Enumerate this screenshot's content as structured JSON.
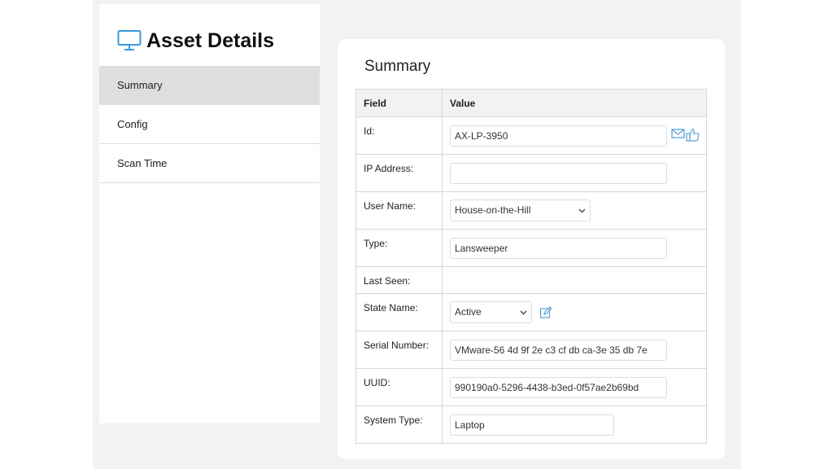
{
  "sidebar": {
    "title": "Asset Details",
    "items": [
      {
        "label": "Summary"
      },
      {
        "label": "Config"
      },
      {
        "label": "Scan Time"
      }
    ]
  },
  "summary": {
    "title": "Summary",
    "headers": {
      "field": "Field",
      "value": "Value"
    },
    "rows": {
      "id": {
        "label": "Id:",
        "value": "AX-LP-3950"
      },
      "ip": {
        "label": "IP Address:",
        "value": ""
      },
      "user": {
        "label": "User Name:",
        "value": "House-on-the-Hill"
      },
      "type": {
        "label": "Type:",
        "value": "Lansweeper"
      },
      "last_seen": {
        "label": "Last Seen:",
        "value": ""
      },
      "state": {
        "label": "State Name:",
        "value": "Active"
      },
      "serial": {
        "label": "Serial Number:",
        "value": "VMware-56 4d 9f 2e c3 cf db ca-3e 35 db 7e"
      },
      "uuid": {
        "label": "UUID:",
        "value": "990190a0-5296-4438-b3ed-0f57ae2b69bd"
      },
      "system_type": {
        "label": "System Type:",
        "value": "Laptop"
      }
    }
  },
  "icons": {
    "monitor": "monitor-icon",
    "email": "email-icon",
    "thumbs_up": "thumbs-up-icon",
    "edit": "edit-icon",
    "chevron": "chevron-down-icon"
  },
  "colors": {
    "accent": "#3b9ad9",
    "active_nav": "#dedede",
    "background": "#f2f2f2"
  }
}
